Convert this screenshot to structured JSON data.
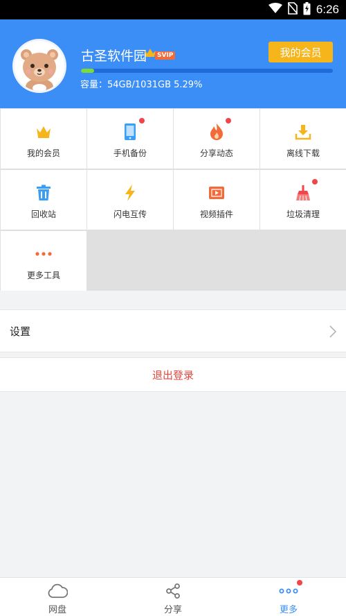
{
  "status_bar": {
    "time": "6:26"
  },
  "profile": {
    "username": "古圣软件园",
    "badge": "SVIP",
    "member_button": "我的会员",
    "storage_text": "容量：54GB/1031GB 5.29%",
    "storage_fraction": 0.0529
  },
  "tools": [
    {
      "label": "我的会员",
      "icon": "crown-icon",
      "color": "#f7b51c",
      "badge_dot": false
    },
    {
      "label": "手机备份",
      "icon": "phone-icon",
      "color": "#3a9ef6",
      "badge_dot": true
    },
    {
      "label": "分享动态",
      "icon": "flame-icon",
      "color": "#f26b3a",
      "badge_dot": true
    },
    {
      "label": "离线下载",
      "icon": "download-icon",
      "color": "#f7b51c",
      "badge_dot": false
    },
    {
      "label": "回收站",
      "icon": "trash-icon",
      "color": "#3a9ef6",
      "badge_dot": false
    },
    {
      "label": "闪电互传",
      "icon": "lightning-icon",
      "color": "#f7b51c",
      "badge_dot": false
    },
    {
      "label": "视频插件",
      "icon": "video-icon",
      "color": "#f26b3a",
      "badge_dot": false
    },
    {
      "label": "垃圾清理",
      "icon": "broom-icon",
      "color": "#f0464a",
      "badge_dot": true
    },
    {
      "label": "更多工具",
      "icon": "more-dots-icon",
      "color": "#f26b3a",
      "badge_dot": false
    }
  ],
  "settings": {
    "label": "设置"
  },
  "logout": {
    "label": "退出登录"
  },
  "tabbar": {
    "tabs": [
      {
        "label": "网盘",
        "icon": "cloud-icon",
        "active": false
      },
      {
        "label": "分享",
        "icon": "share-icon",
        "active": false
      },
      {
        "label": "更多",
        "icon": "more-dots-icon",
        "active": true,
        "badge_dot": true
      }
    ]
  },
  "colors": {
    "accent": "#3a8ef6",
    "member": "#f7b51c",
    "danger": "#e8453c",
    "progress": "#7cdb3a"
  }
}
